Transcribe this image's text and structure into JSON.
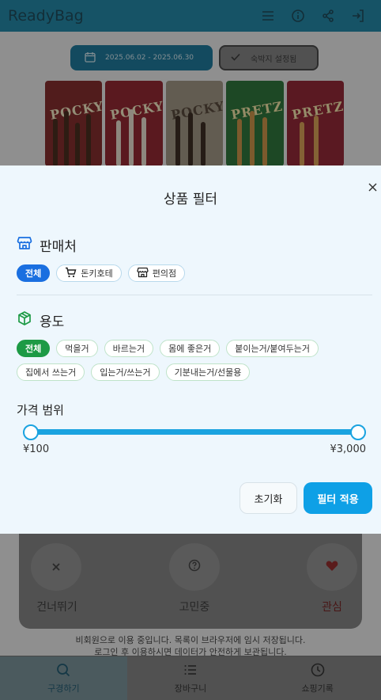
{
  "app": {
    "title": "ReadyBag",
    "date_range": "2025.06.02 - 2025.06.30",
    "lodging_button": "숙박지 설정됨",
    "brand_names": [
      "POCKY",
      "POCKY",
      "POCKY",
      "PRETZ",
      "PRETZ"
    ]
  },
  "card": {
    "skip_label": "건너뛰기",
    "thinking_label": "고민중",
    "interest_label": "관심"
  },
  "notice": {
    "line1": "비회원으로 이용 중입니다. 목록이 브라우저에 임시 저장됩니다.",
    "line2": "로그인 후 이용하시면 데이터가 안전하게 보관됩니다."
  },
  "nav": {
    "browse": "구경하기",
    "cart": "장바구니",
    "history": "쇼핑기록"
  },
  "modal": {
    "title": "상품 필터",
    "seller": {
      "heading": "판매처",
      "options": [
        "전체",
        "돈키호테",
        "편의점"
      ],
      "selected": "전체"
    },
    "usage": {
      "heading": "용도",
      "options": [
        "전체",
        "먹을거",
        "바르는거",
        "몸에 좋은거",
        "붙이는거/붙여두는거",
        "집에서 쓰는거",
        "입는거/쓰는거",
        "기분내는거/선물용"
      ],
      "selected": "전체"
    },
    "price": {
      "heading": "가격 범위",
      "min_label": "¥100",
      "max_label": "¥3,000",
      "min_value": 100,
      "max_value": 3000
    },
    "reset_label": "초기화",
    "apply_label": "필터 적용"
  },
  "colors": {
    "primary": "#0ea0e6",
    "seller_selected": "#1a6fe0",
    "usage_selected": "#1d9a45",
    "modal_bg": "#eef7fd"
  }
}
